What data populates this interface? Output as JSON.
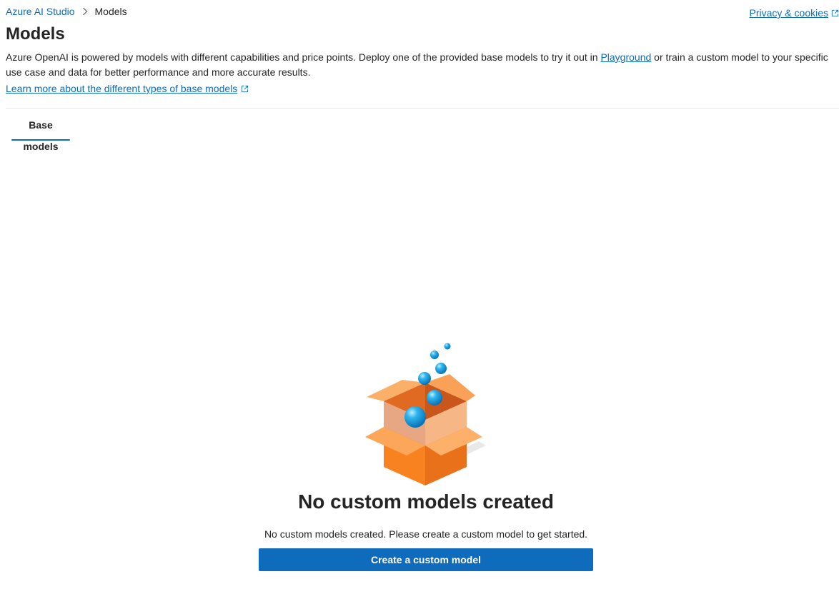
{
  "breadcrumb": {
    "root": "Azure AI Studio",
    "current": "Models"
  },
  "header": {
    "privacy_link": "Privacy & cookies"
  },
  "page": {
    "title": "Models",
    "description_before": "Azure OpenAI is powered by models with different capabilities and price points. Deploy one of the provided base models to try it out in ",
    "playground_link": "Playground",
    "description_after": " or train a custom model to your specific use case and data for better performance and more accurate results.",
    "learn_more_link": "Learn more about the different types of base models"
  },
  "tabs": [
    {
      "label": "Base models",
      "selected": true
    }
  ],
  "empty_state": {
    "illustration": "open-box-with-bubbles-icon",
    "title": "No custom models created",
    "message": "No custom models created. Please create a custom model to get started.",
    "button_label": "Create a custom model"
  },
  "colors": {
    "accent": "#0f6cbd",
    "box_orange": "#f57c1f",
    "bubble_blue": "#1aa1de"
  }
}
